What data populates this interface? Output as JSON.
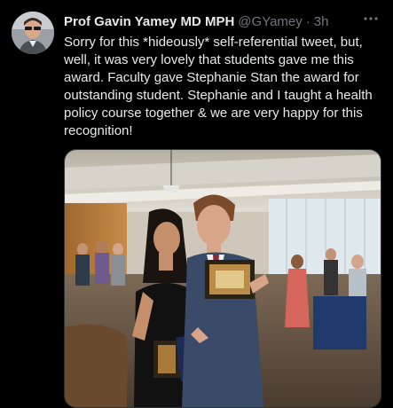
{
  "tweet": {
    "author_name": "Prof Gavin Yamey MD MPH",
    "handle": "@GYamey",
    "separator": "·",
    "time": "3h",
    "text": "Sorry for this *hideously* self-referential tweet, but, well, it was very lovely that students gave me this award. Faculty gave Stephanie Stan the award for outstanding student. Stephanie and I taught a health policy course together & we are very happy for this recognition!",
    "more_icon": "more-horizontal-icon",
    "media_description_icon": "photo"
  },
  "colors": {
    "background": "#000000",
    "text": "#e7e9ea",
    "secondary_text": "#71767b",
    "border": "#2f3336"
  }
}
